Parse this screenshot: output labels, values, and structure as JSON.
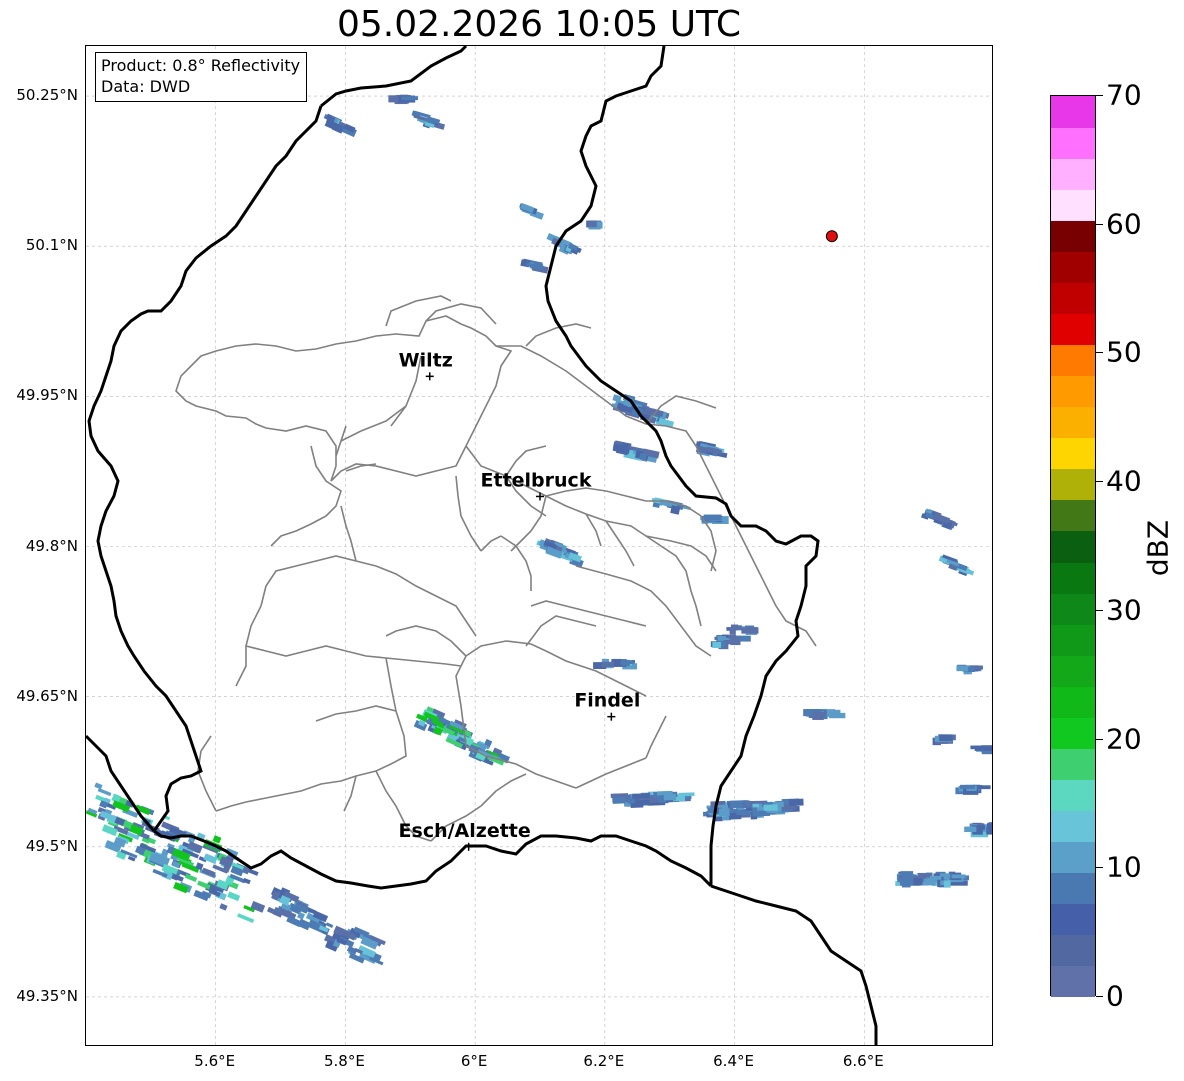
{
  "title": "05.02.2026 10:05 UTC",
  "info_box": {
    "product": "Product: 0.8° Reflectivity",
    "data": "Data: DWD"
  },
  "lat_labels": [
    "50.25°N",
    "50.1°N",
    "49.95°N",
    "49.8°N",
    "49.65°N",
    "49.5°N",
    "49.35°N"
  ],
  "lon_labels": [
    "5.6°E",
    "5.8°E",
    "6°E",
    "6.2°E",
    "6.4°E",
    "6.6°E"
  ],
  "lat_ticks": [
    50.25,
    50.1,
    49.95,
    49.8,
    49.65,
    49.5,
    49.35
  ],
  "lon_ticks": [
    5.6,
    5.8,
    6.0,
    6.2,
    6.4,
    6.6
  ],
  "map_extent": {
    "lon_min": 5.4,
    "lon_max": 6.8,
    "lat_min": 49.3,
    "lat_max": 50.3
  },
  "cities": [
    {
      "name": "Wiltz",
      "lon": 5.93,
      "lat": 49.97
    },
    {
      "name": "Ettelbruck",
      "lon": 6.1,
      "lat": 49.85
    },
    {
      "name": "Findel",
      "lon": 6.21,
      "lat": 49.63
    },
    {
      "name": "Esch/Alzette",
      "lon": 5.99,
      "lat": 49.5
    }
  ],
  "radar_site": {
    "lon": 6.55,
    "lat": 50.11,
    "color": "#e01010"
  },
  "colorbar": {
    "label": "dBZ",
    "ticks": [
      "0",
      "10",
      "20",
      "30",
      "40",
      "50",
      "60",
      "70"
    ],
    "min": 0,
    "max": 70,
    "colors": [
      "#6070a8",
      "#5268a0",
      "#4560a8",
      "#4a78b0",
      "#5aa0c8",
      "#68c4d8",
      "#5cd8c0",
      "#3ed070",
      "#10c820",
      "#10b818",
      "#12a818",
      "#109818",
      "#0e8818",
      "#0a7810",
      "#0a6010",
      "#427816",
      "#afb008",
      "#ffd500",
      "#fbb000",
      "#ff9a00",
      "#ff7a00",
      "#e00000",
      "#c00000",
      "#a00000",
      "#780000",
      "#ffe0ff",
      "#ffb0ff",
      "#ff70ff",
      "#e837e8"
    ]
  }
}
